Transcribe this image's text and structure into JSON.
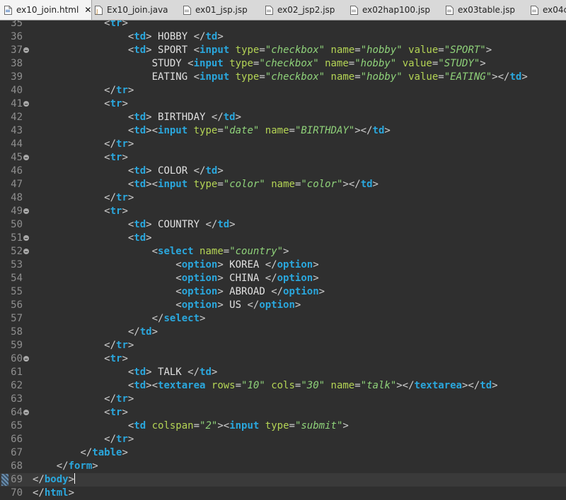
{
  "tabs": [
    {
      "label": "ex10_join.html",
      "active": true,
      "icon": "html-file-icon",
      "closable": true
    },
    {
      "label": "Ex10_join.java",
      "active": false,
      "icon": "java-file-icon"
    },
    {
      "label": "ex01_jsp.jsp",
      "active": false,
      "icon": "jsp-file-icon"
    },
    {
      "label": "ex02_jsp2.jsp",
      "active": false,
      "icon": "jsp-file-icon"
    },
    {
      "label": "ex02hap100.jsp",
      "active": false,
      "icon": "jsp-file-icon"
    },
    {
      "label": "ex03table.jsp",
      "active": false,
      "icon": "jsp-file-icon"
    },
    {
      "label": "ex04c",
      "active": false,
      "icon": "jsp-file-icon"
    }
  ],
  "tab_close": "✕",
  "colors": {
    "tag": "#2aa7dd",
    "attr": "#b4d455",
    "value": "#8fd27a",
    "text": "#e0e0e0",
    "background": "#2f2f2f"
  },
  "current_line": 69,
  "lines": [
    {
      "n": "35",
      "fold": false,
      "code": [
        [
          "ws",
          "            "
        ],
        [
          "b",
          "<"
        ],
        [
          "t",
          "tr"
        ],
        [
          "b",
          ">"
        ]
      ]
    },
    {
      "n": "36",
      "fold": false,
      "code": [
        [
          "ws",
          "                "
        ],
        [
          "b",
          "<"
        ],
        [
          "t",
          "td"
        ],
        [
          "b",
          ">"
        ],
        [
          "x",
          " HOBBY "
        ],
        [
          "b",
          "</"
        ],
        [
          "t",
          "td"
        ],
        [
          "b",
          ">"
        ]
      ]
    },
    {
      "n": "37",
      "fold": true,
      "code": [
        [
          "ws",
          "                "
        ],
        [
          "b",
          "<"
        ],
        [
          "t",
          "td"
        ],
        [
          "b",
          ">"
        ],
        [
          "x",
          " SPORT "
        ],
        [
          "b",
          "<"
        ],
        [
          "t",
          "input"
        ],
        [
          "x",
          " "
        ],
        [
          "a",
          "type"
        ],
        [
          "b",
          "="
        ],
        [
          "v",
          "\"checkbox\""
        ],
        [
          "x",
          " "
        ],
        [
          "a",
          "name"
        ],
        [
          "b",
          "="
        ],
        [
          "v",
          "\"hobby\""
        ],
        [
          "x",
          " "
        ],
        [
          "a",
          "value"
        ],
        [
          "b",
          "="
        ],
        [
          "v",
          "\"SPORT\""
        ],
        [
          "b",
          ">"
        ]
      ]
    },
    {
      "n": "38",
      "fold": false,
      "code": [
        [
          "ws",
          "                    "
        ],
        [
          "x",
          "STUDY "
        ],
        [
          "b",
          "<"
        ],
        [
          "t",
          "input"
        ],
        [
          "x",
          " "
        ],
        [
          "a",
          "type"
        ],
        [
          "b",
          "="
        ],
        [
          "v",
          "\"checkbox\""
        ],
        [
          "x",
          " "
        ],
        [
          "a",
          "name"
        ],
        [
          "b",
          "="
        ],
        [
          "v",
          "\"hobby\""
        ],
        [
          "x",
          " "
        ],
        [
          "a",
          "value"
        ],
        [
          "b",
          "="
        ],
        [
          "v",
          "\"STUDY\""
        ],
        [
          "b",
          ">"
        ]
      ]
    },
    {
      "n": "39",
      "fold": false,
      "code": [
        [
          "ws",
          "                    "
        ],
        [
          "x",
          "EATING "
        ],
        [
          "b",
          "<"
        ],
        [
          "t",
          "input"
        ],
        [
          "x",
          " "
        ],
        [
          "a",
          "type"
        ],
        [
          "b",
          "="
        ],
        [
          "v",
          "\"checkbox\""
        ],
        [
          "x",
          " "
        ],
        [
          "a",
          "name"
        ],
        [
          "b",
          "="
        ],
        [
          "v",
          "\"hobby\""
        ],
        [
          "x",
          " "
        ],
        [
          "a",
          "value"
        ],
        [
          "b",
          "="
        ],
        [
          "v",
          "\"EATING\""
        ],
        [
          "b",
          "></"
        ],
        [
          "t",
          "td"
        ],
        [
          "b",
          ">"
        ]
      ]
    },
    {
      "n": "40",
      "fold": false,
      "code": [
        [
          "ws",
          "            "
        ],
        [
          "b",
          "</"
        ],
        [
          "t",
          "tr"
        ],
        [
          "b",
          ">"
        ]
      ]
    },
    {
      "n": "41",
      "fold": true,
      "code": [
        [
          "ws",
          "            "
        ],
        [
          "b",
          "<"
        ],
        [
          "t",
          "tr"
        ],
        [
          "b",
          ">"
        ]
      ]
    },
    {
      "n": "42",
      "fold": false,
      "code": [
        [
          "ws",
          "                "
        ],
        [
          "b",
          "<"
        ],
        [
          "t",
          "td"
        ],
        [
          "b",
          ">"
        ],
        [
          "x",
          " BIRTHDAY "
        ],
        [
          "b",
          "</"
        ],
        [
          "t",
          "td"
        ],
        [
          "b",
          ">"
        ]
      ]
    },
    {
      "n": "43",
      "fold": false,
      "code": [
        [
          "ws",
          "                "
        ],
        [
          "b",
          "<"
        ],
        [
          "t",
          "td"
        ],
        [
          "b",
          "><"
        ],
        [
          "t",
          "input"
        ],
        [
          "x",
          " "
        ],
        [
          "a",
          "type"
        ],
        [
          "b",
          "="
        ],
        [
          "v",
          "\"date\""
        ],
        [
          "x",
          " "
        ],
        [
          "a",
          "name"
        ],
        [
          "b",
          "="
        ],
        [
          "v",
          "\"BIRTHDAY\""
        ],
        [
          "b",
          "></"
        ],
        [
          "t",
          "td"
        ],
        [
          "b",
          ">"
        ]
      ]
    },
    {
      "n": "44",
      "fold": false,
      "code": [
        [
          "ws",
          "            "
        ],
        [
          "b",
          "</"
        ],
        [
          "t",
          "tr"
        ],
        [
          "b",
          ">"
        ]
      ]
    },
    {
      "n": "45",
      "fold": true,
      "code": [
        [
          "ws",
          "            "
        ],
        [
          "b",
          "<"
        ],
        [
          "t",
          "tr"
        ],
        [
          "b",
          ">"
        ]
      ]
    },
    {
      "n": "46",
      "fold": false,
      "code": [
        [
          "ws",
          "                "
        ],
        [
          "b",
          "<"
        ],
        [
          "t",
          "td"
        ],
        [
          "b",
          ">"
        ],
        [
          "x",
          " COLOR "
        ],
        [
          "b",
          "</"
        ],
        [
          "t",
          "td"
        ],
        [
          "b",
          ">"
        ]
      ]
    },
    {
      "n": "47",
      "fold": false,
      "code": [
        [
          "ws",
          "                "
        ],
        [
          "b",
          "<"
        ],
        [
          "t",
          "td"
        ],
        [
          "b",
          "><"
        ],
        [
          "t",
          "input"
        ],
        [
          "x",
          " "
        ],
        [
          "a",
          "type"
        ],
        [
          "b",
          "="
        ],
        [
          "v",
          "\"color\""
        ],
        [
          "x",
          " "
        ],
        [
          "a",
          "name"
        ],
        [
          "b",
          "="
        ],
        [
          "v",
          "\"color\""
        ],
        [
          "b",
          "></"
        ],
        [
          "t",
          "td"
        ],
        [
          "b",
          ">"
        ]
      ]
    },
    {
      "n": "48",
      "fold": false,
      "code": [
        [
          "ws",
          "            "
        ],
        [
          "b",
          "</"
        ],
        [
          "t",
          "tr"
        ],
        [
          "b",
          ">"
        ]
      ]
    },
    {
      "n": "49",
      "fold": true,
      "code": [
        [
          "ws",
          "            "
        ],
        [
          "b",
          "<"
        ],
        [
          "t",
          "tr"
        ],
        [
          "b",
          ">"
        ]
      ]
    },
    {
      "n": "50",
      "fold": false,
      "code": [
        [
          "ws",
          "                "
        ],
        [
          "b",
          "<"
        ],
        [
          "t",
          "td"
        ],
        [
          "b",
          ">"
        ],
        [
          "x",
          " COUNTRY "
        ],
        [
          "b",
          "</"
        ],
        [
          "t",
          "td"
        ],
        [
          "b",
          ">"
        ]
      ]
    },
    {
      "n": "51",
      "fold": true,
      "code": [
        [
          "ws",
          "                "
        ],
        [
          "b",
          "<"
        ],
        [
          "t",
          "td"
        ],
        [
          "b",
          ">"
        ]
      ]
    },
    {
      "n": "52",
      "fold": true,
      "code": [
        [
          "ws",
          "                    "
        ],
        [
          "b",
          "<"
        ],
        [
          "t",
          "select"
        ],
        [
          "x",
          " "
        ],
        [
          "a",
          "name"
        ],
        [
          "b",
          "="
        ],
        [
          "v",
          "\"country\""
        ],
        [
          "b",
          ">"
        ]
      ]
    },
    {
      "n": "53",
      "fold": false,
      "code": [
        [
          "ws",
          "                        "
        ],
        [
          "b",
          "<"
        ],
        [
          "t",
          "option"
        ],
        [
          "b",
          ">"
        ],
        [
          "x",
          " KOREA "
        ],
        [
          "b",
          "</"
        ],
        [
          "t",
          "option"
        ],
        [
          "b",
          ">"
        ]
      ]
    },
    {
      "n": "54",
      "fold": false,
      "code": [
        [
          "ws",
          "                        "
        ],
        [
          "b",
          "<"
        ],
        [
          "t",
          "option"
        ],
        [
          "b",
          ">"
        ],
        [
          "x",
          " CHINA "
        ],
        [
          "b",
          "</"
        ],
        [
          "t",
          "option"
        ],
        [
          "b",
          ">"
        ]
      ]
    },
    {
      "n": "55",
      "fold": false,
      "code": [
        [
          "ws",
          "                        "
        ],
        [
          "b",
          "<"
        ],
        [
          "t",
          "option"
        ],
        [
          "b",
          ">"
        ],
        [
          "x",
          " ABROAD "
        ],
        [
          "b",
          "</"
        ],
        [
          "t",
          "option"
        ],
        [
          "b",
          ">"
        ]
      ]
    },
    {
      "n": "56",
      "fold": false,
      "code": [
        [
          "ws",
          "                        "
        ],
        [
          "b",
          "<"
        ],
        [
          "t",
          "option"
        ],
        [
          "b",
          ">"
        ],
        [
          "x",
          " US "
        ],
        [
          "b",
          "</"
        ],
        [
          "t",
          "option"
        ],
        [
          "b",
          ">"
        ]
      ]
    },
    {
      "n": "57",
      "fold": false,
      "code": [
        [
          "ws",
          "                    "
        ],
        [
          "b",
          "</"
        ],
        [
          "t",
          "select"
        ],
        [
          "b",
          ">"
        ]
      ]
    },
    {
      "n": "58",
      "fold": false,
      "code": [
        [
          "ws",
          "                "
        ],
        [
          "b",
          "</"
        ],
        [
          "t",
          "td"
        ],
        [
          "b",
          ">"
        ]
      ]
    },
    {
      "n": "59",
      "fold": false,
      "code": [
        [
          "ws",
          "            "
        ],
        [
          "b",
          "</"
        ],
        [
          "t",
          "tr"
        ],
        [
          "b",
          ">"
        ]
      ]
    },
    {
      "n": "60",
      "fold": true,
      "code": [
        [
          "ws",
          "            "
        ],
        [
          "b",
          "<"
        ],
        [
          "t",
          "tr"
        ],
        [
          "b",
          ">"
        ]
      ]
    },
    {
      "n": "61",
      "fold": false,
      "code": [
        [
          "ws",
          "                "
        ],
        [
          "b",
          "<"
        ],
        [
          "t",
          "td"
        ],
        [
          "b",
          ">"
        ],
        [
          "x",
          " TALK "
        ],
        [
          "b",
          "</"
        ],
        [
          "t",
          "td"
        ],
        [
          "b",
          ">"
        ]
      ]
    },
    {
      "n": "62",
      "fold": false,
      "code": [
        [
          "ws",
          "                "
        ],
        [
          "b",
          "<"
        ],
        [
          "t",
          "td"
        ],
        [
          "b",
          "><"
        ],
        [
          "t",
          "textarea"
        ],
        [
          "x",
          " "
        ],
        [
          "a",
          "rows"
        ],
        [
          "b",
          "="
        ],
        [
          "v",
          "\"10\""
        ],
        [
          "x",
          " "
        ],
        [
          "a",
          "cols"
        ],
        [
          "b",
          "="
        ],
        [
          "v",
          "\"30\""
        ],
        [
          "x",
          " "
        ],
        [
          "a",
          "name"
        ],
        [
          "b",
          "="
        ],
        [
          "v",
          "\"talk\""
        ],
        [
          "b",
          "></"
        ],
        [
          "t",
          "textarea"
        ],
        [
          "b",
          "></"
        ],
        [
          "t",
          "td"
        ],
        [
          "b",
          ">"
        ]
      ]
    },
    {
      "n": "63",
      "fold": false,
      "code": [
        [
          "ws",
          "            "
        ],
        [
          "b",
          "</"
        ],
        [
          "t",
          "tr"
        ],
        [
          "b",
          ">"
        ]
      ]
    },
    {
      "n": "64",
      "fold": true,
      "code": [
        [
          "ws",
          "            "
        ],
        [
          "b",
          "<"
        ],
        [
          "t",
          "tr"
        ],
        [
          "b",
          ">"
        ]
      ]
    },
    {
      "n": "65",
      "fold": false,
      "code": [
        [
          "ws",
          "                "
        ],
        [
          "b",
          "<"
        ],
        [
          "t",
          "td"
        ],
        [
          "x",
          " "
        ],
        [
          "a",
          "colspan"
        ],
        [
          "b",
          "="
        ],
        [
          "v",
          "\"2\""
        ],
        [
          "b",
          "><"
        ],
        [
          "t",
          "input"
        ],
        [
          "x",
          " "
        ],
        [
          "a",
          "type"
        ],
        [
          "b",
          "="
        ],
        [
          "v",
          "\"submit\""
        ],
        [
          "b",
          ">"
        ]
      ]
    },
    {
      "n": "66",
      "fold": false,
      "code": [
        [
          "ws",
          "            "
        ],
        [
          "b",
          "</"
        ],
        [
          "t",
          "tr"
        ],
        [
          "b",
          ">"
        ]
      ]
    },
    {
      "n": "67",
      "fold": false,
      "code": [
        [
          "ws",
          "        "
        ],
        [
          "b",
          "</"
        ],
        [
          "t",
          "table"
        ],
        [
          "b",
          ">"
        ]
      ]
    },
    {
      "n": "68",
      "fold": false,
      "code": [
        [
          "ws",
          "    "
        ],
        [
          "b",
          "</"
        ],
        [
          "t",
          "form"
        ],
        [
          "b",
          ">"
        ]
      ]
    },
    {
      "n": "69",
      "fold": false,
      "code": [
        [
          "b",
          "</"
        ],
        [
          "t",
          "body"
        ],
        [
          "b",
          ">"
        ]
      ]
    },
    {
      "n": "70",
      "fold": false,
      "code": [
        [
          "b",
          "</"
        ],
        [
          "t",
          "html"
        ],
        [
          "b",
          ">"
        ]
      ]
    }
  ]
}
